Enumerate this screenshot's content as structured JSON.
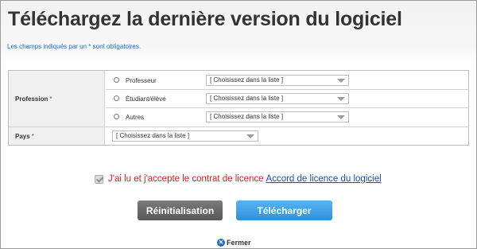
{
  "header": {
    "title": "Téléchargez la dernière version du logiciel",
    "required_note": "Les champs indiqués par un * sont obligatoires."
  },
  "form": {
    "profession": {
      "label": "Profession",
      "required_mark": "*",
      "options": [
        {
          "label": "Professeur",
          "select_value": "[ Choisissez dans la liste ]"
        },
        {
          "label": "Étudiant/élève",
          "select_value": "[ Choisissez dans la liste ]"
        },
        {
          "label": "Autres",
          "select_value": "[ Choisissez dans la liste ]"
        }
      ]
    },
    "country": {
      "label": "Pays",
      "required_mark": "*",
      "select_value": "[ Choisissez dans la liste ]"
    }
  },
  "license": {
    "accept_text": "J'ai lu et j'accepte le contrat de licence",
    "link_text": "Accord de licence du logiciel"
  },
  "buttons": {
    "reset_label": "Réinitialisation",
    "download_label": "Télécharger"
  },
  "footer": {
    "close_label": "Fermer",
    "close_icon": "close-icon"
  },
  "colors": {
    "title": "#333333",
    "note": "#1a6fc0",
    "accept_text": "#d41f1f",
    "link": "#1a4fb0",
    "download_button": "#2d92dc",
    "reset_button": "#595959"
  }
}
